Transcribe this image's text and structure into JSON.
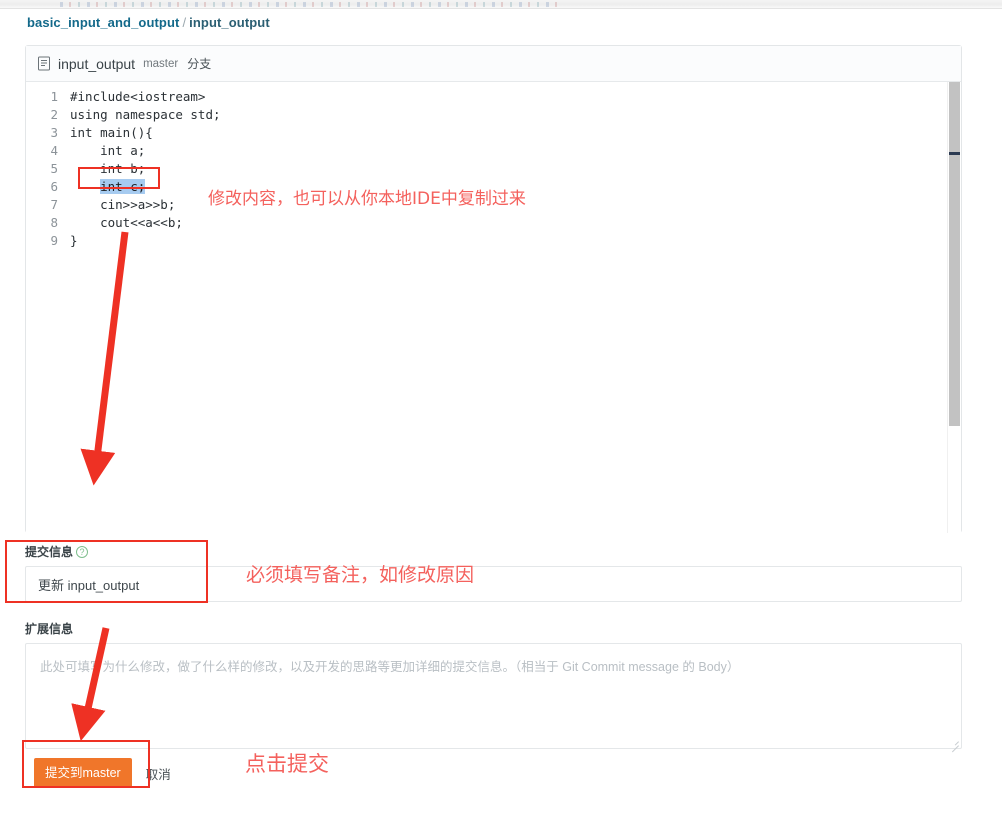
{
  "breadcrumb": {
    "repo": "basic_input_and_output",
    "separator": "/",
    "current": "input_output"
  },
  "editor": {
    "file_icon": "file-document-icon",
    "file_name": "input_output",
    "branch": "master",
    "branch_suffix": "分支",
    "line_numbers": [
      "1",
      "2",
      "3",
      "4",
      "5",
      "6",
      "7",
      "8",
      "9"
    ],
    "code_lines": [
      "#include<iostream>",
      "using namespace std;",
      "int main(){",
      "    int a;",
      "    int b;",
      "    int c;",
      "    cin>>a>>b;",
      "    cout<<a<<b;",
      "}"
    ],
    "selected_line_index": 5,
    "selected_text": "int c;"
  },
  "commit": {
    "label": "提交信息",
    "help_icon": "question-mark-icon",
    "value": "更新 input_output",
    "placeholder": "更新 input_output"
  },
  "extended": {
    "label": "扩展信息",
    "value": "",
    "placeholder": "此处可填写为什么修改，做了什么样的修改，以及开发的思路等更加详细的提交信息。（相当于 Git Commit message 的 Body）"
  },
  "actions": {
    "submit_label": "提交到master",
    "cancel_label": "取消",
    "submit_color": "#f0762a"
  },
  "annotations": {
    "color": "#ee3124",
    "text_color": "#f4615d",
    "note_code": "修改内容，也可以从你本地IDE中复制过来",
    "note_commit": "必须填写备注，如修改原因",
    "note_submit": "点击提交"
  }
}
